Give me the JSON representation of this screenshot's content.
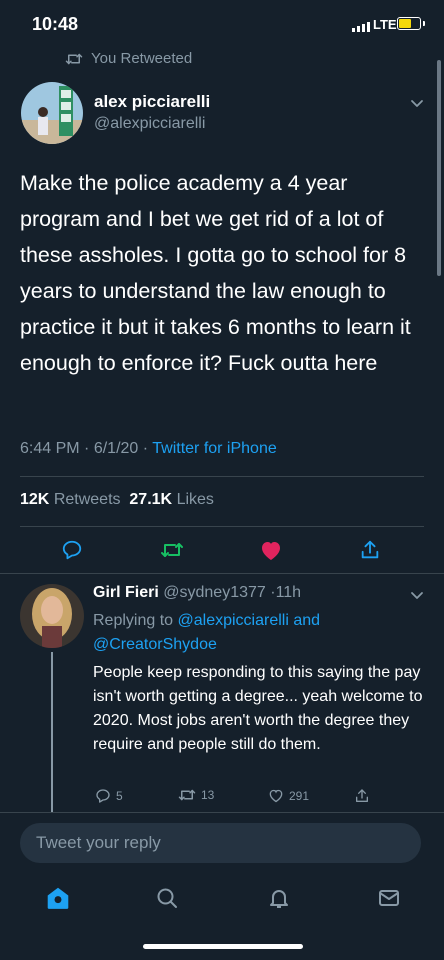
{
  "status_bar": {
    "time": "10:48",
    "network": "LTE",
    "battery_level": 0.55
  },
  "retweet_context": {
    "label": "You Retweeted"
  },
  "tweet": {
    "author_name": "alex picciarelli",
    "author_handle": "@alexpicciarelli",
    "text": "Make the police academy a 4 year program and I bet we get rid of a lot of these assholes. I gotta go to school for 8 years to understand the law enough to practice it but it takes 6 months to learn it enough to enforce it? Fuck outta here",
    "time": "6:44 PM",
    "date": "6/1/20",
    "separator": "·",
    "source": "Twitter for iPhone",
    "retweets_count": "12K",
    "retweets_label": "Retweets",
    "likes_count": "27.1K",
    "likes_label": "Likes"
  },
  "reply": {
    "author_name": "Girl Fieri",
    "author_handle": "@sydney1377",
    "age": "11h",
    "replying_to_label": "Replying to",
    "replying_to_users": "@alexpicciarelli and",
    "replying_to_users_2": "@CreatorShydoe",
    "text": "People keep responding to this saying the pay isn't worth getting a degree... yeah welcome to 2020. Most jobs aren't worth the degree they require and people still do them.",
    "replies_count": "5",
    "retweets_count": "13",
    "likes_count": "291"
  },
  "compose": {
    "placeholder": "Tweet your reply"
  },
  "colors": {
    "background": "#15202b",
    "accent": "#1da1f2",
    "retweet_green": "#17bf63",
    "like_pink": "#e0245e",
    "muted": "#8899a6"
  },
  "icons": {
    "retweet": "retweet-icon",
    "reply": "reply-icon",
    "like": "heart-icon",
    "share": "share-icon",
    "home": "home-icon",
    "search": "search-icon",
    "notifications": "bell-icon",
    "messages": "mail-icon"
  }
}
